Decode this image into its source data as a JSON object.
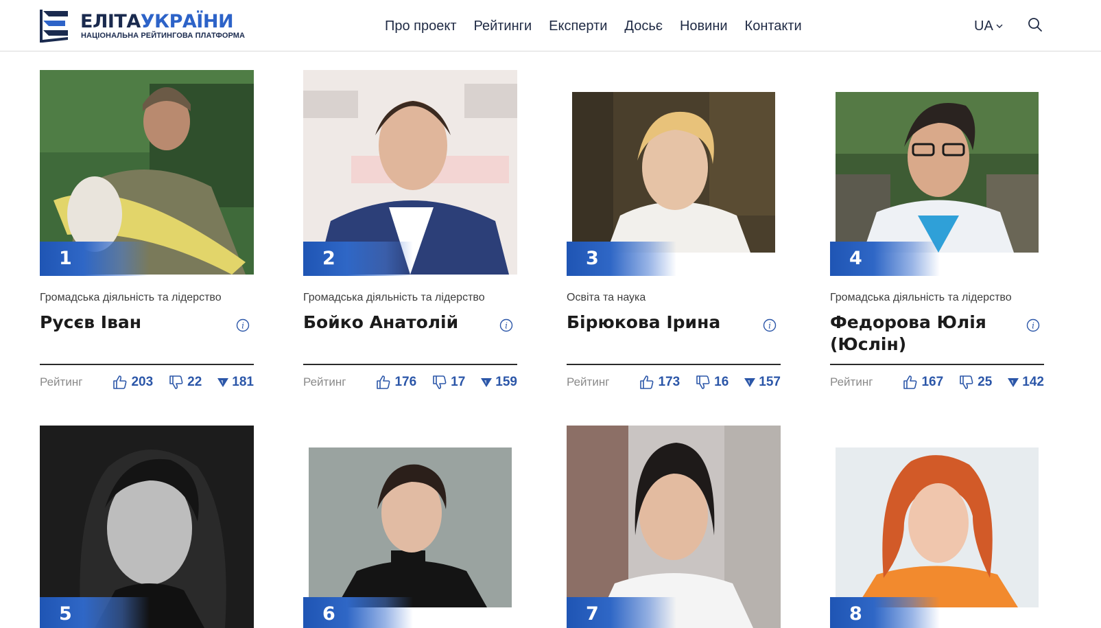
{
  "brand": {
    "title_part1": "ЕЛІТА",
    "title_part2": "УКРАЇНИ",
    "subtitle": "НАЦІОНАЛЬНА РЕЙТИНГОВА ПЛАТФОРМА",
    "colors": {
      "dark": "#1a2a4e",
      "accent": "#2d63c8"
    }
  },
  "nav": {
    "items": [
      "Про проект",
      "Рейтинги",
      "Експерти",
      "Досьє",
      "Новини",
      "Контакти"
    ],
    "lang": "UA"
  },
  "stats_label": "Рейтинг",
  "cards": [
    {
      "rank": "1",
      "category": "Громадська діяльність та лідерство",
      "name": "Русєв Іван",
      "likes": "203",
      "dislikes": "22",
      "score": "181"
    },
    {
      "rank": "2",
      "category": "Громадська діяльність та лідерство",
      "name": "Бойко Анатолій",
      "likes": "176",
      "dislikes": "17",
      "score": "159"
    },
    {
      "rank": "3",
      "category": "Освіта та наука",
      "name": "Бірюкова Ірина",
      "likes": "173",
      "dislikes": "16",
      "score": "157"
    },
    {
      "rank": "4",
      "category": "Громадська діяльність та лідерство",
      "name": "Федорова Юлія (Юслін)",
      "likes": "167",
      "dislikes": "25",
      "score": "142"
    },
    {
      "rank": "5"
    },
    {
      "rank": "6"
    },
    {
      "rank": "7"
    },
    {
      "rank": "8"
    }
  ],
  "icons": {
    "like": "thumbs-up-icon",
    "dislike": "thumbs-down-icon",
    "score": "triangle-down-icon",
    "info": "info-icon",
    "search": "search-icon"
  }
}
